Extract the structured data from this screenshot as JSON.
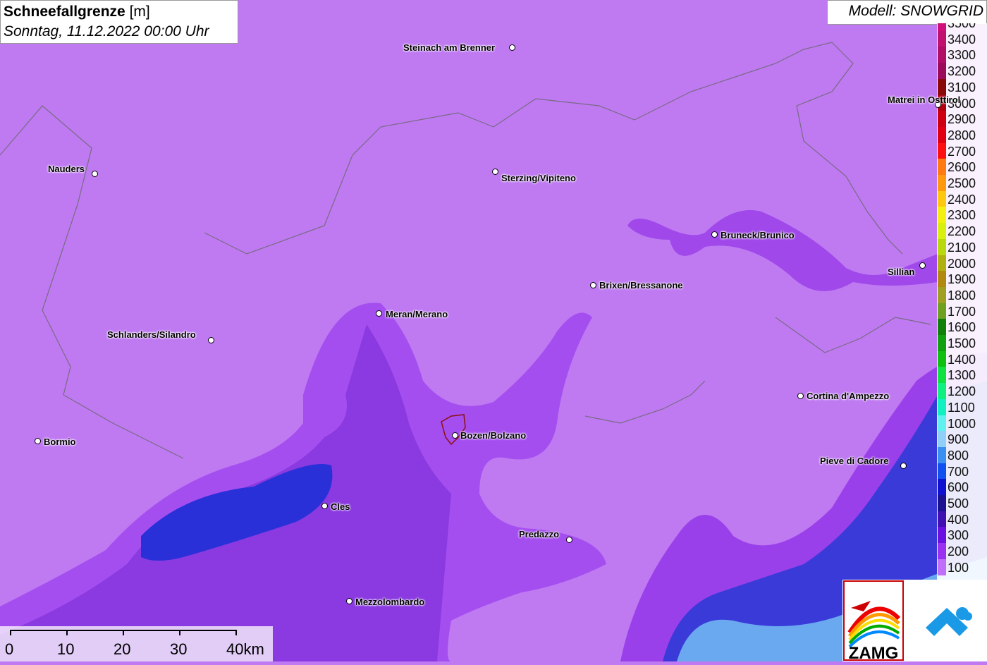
{
  "title": {
    "variable": "Schneefallgrenze",
    "unit": "[m]",
    "datetime": "Sonntag, 11.12.2022 00:00 Uhr"
  },
  "model": "Modell: SNOWGRID",
  "legend": [
    {
      "label": "3500",
      "color": "#d0107a"
    },
    {
      "label": "3400",
      "color": "#c01070"
    },
    {
      "label": "3300",
      "color": "#b00d66"
    },
    {
      "label": "3200",
      "color": "#9a0b5a"
    },
    {
      "label": "3100",
      "color": "#8a0a0a"
    },
    {
      "label": "3000",
      "color": "#b00010"
    },
    {
      "label": "2900",
      "color": "#cc0010"
    },
    {
      "label": "2800",
      "color": "#e00010"
    },
    {
      "label": "2700",
      "color": "#ff1010"
    },
    {
      "label": "2600",
      "color": "#ff7a10"
    },
    {
      "label": "2500",
      "color": "#ff9a10"
    },
    {
      "label": "2400",
      "color": "#ffc810"
    },
    {
      "label": "2300",
      "color": "#f2f010"
    },
    {
      "label": "2200",
      "color": "#d8f010"
    },
    {
      "label": "2100",
      "color": "#b8d810"
    },
    {
      "label": "2000",
      "color": "#b0b010"
    },
    {
      "label": "1900",
      "color": "#b08a10"
    },
    {
      "label": "1800",
      "color": "#a0a020"
    },
    {
      "label": "1700",
      "color": "#70a020"
    },
    {
      "label": "1600",
      "color": "#10800a"
    },
    {
      "label": "1500",
      "color": "#10a010"
    },
    {
      "label": "1400",
      "color": "#10c010"
    },
    {
      "label": "1300",
      "color": "#10e040"
    },
    {
      "label": "1200",
      "color": "#10f080"
    },
    {
      "label": "1100",
      "color": "#10f0c0"
    },
    {
      "label": "1000",
      "color": "#60f0f0"
    },
    {
      "label": "900",
      "color": "#90d0f8"
    },
    {
      "label": "800",
      "color": "#3a90f0"
    },
    {
      "label": "700",
      "color": "#1050f0"
    },
    {
      "label": "600",
      "color": "#1010d0"
    },
    {
      "label": "500",
      "color": "#1a1090"
    },
    {
      "label": "400",
      "color": "#4010b0"
    },
    {
      "label": "300",
      "color": "#6a10e0"
    },
    {
      "label": "200",
      "color": "#9a30f0"
    },
    {
      "label": "100",
      "color": "#c070f8"
    }
  ],
  "cities": [
    {
      "name": "Steinach am Brenner"
    },
    {
      "name": "Nauders"
    },
    {
      "name": "Sterzing/Vipiteno"
    },
    {
      "name": "Matrei in Osttirol"
    },
    {
      "name": "Bruneck/Brunico"
    },
    {
      "name": "Sillian"
    },
    {
      "name": "Brixen/Bressanone"
    },
    {
      "name": "Meran/Merano"
    },
    {
      "name": "Schlanders/Silandro"
    },
    {
      "name": "Cortina d'Ampezzo"
    },
    {
      "name": "Bozen/Bolzano"
    },
    {
      "name": "Bormio"
    },
    {
      "name": "Pieve di Cadore"
    },
    {
      "name": "Cles"
    },
    {
      "name": "Predazzo"
    },
    {
      "name": "Mezzolombardo"
    }
  ],
  "scale": {
    "labels": [
      "0",
      "10",
      "20",
      "30",
      "40km"
    ]
  },
  "logos": {
    "zamg": "ZAMG"
  }
}
